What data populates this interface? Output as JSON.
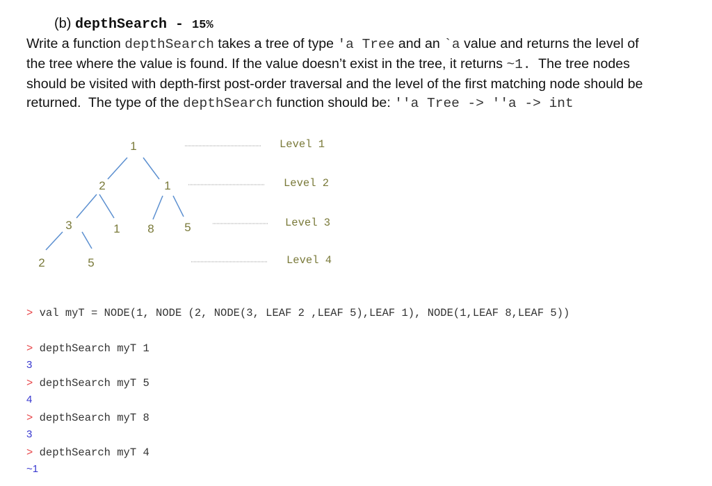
{
  "heading": {
    "part": "(b) ",
    "function_name": "depthSearch",
    "separator": " - ",
    "weight": "15%"
  },
  "description": {
    "lines": [
      [
        {
          "t": "text",
          "v": "Write a function "
        },
        {
          "t": "code",
          "v": "depthSearch"
        },
        {
          "t": "text",
          "v": " takes a tree of type "
        },
        {
          "t": "code",
          "v": "'a Tree"
        },
        {
          "t": "text",
          "v": " and an "
        },
        {
          "t": "code",
          "v": "`a"
        },
        {
          "t": "text",
          "v": " value and returns the level of"
        }
      ],
      [
        {
          "t": "text",
          "v": "the tree where the value is found. If the value doesn’t exist in the tree, it returns "
        },
        {
          "t": "code",
          "v": "~1."
        },
        {
          "t": "text",
          "v": "  The tree nodes"
        }
      ],
      [
        {
          "t": "text",
          "v": "should be visited with depth-first post-order traversal and the level of the first matching node should be"
        }
      ],
      [
        {
          "t": "text",
          "v": "returned.  The type of the "
        },
        {
          "t": "code",
          "v": "depthSearch"
        },
        {
          "t": "text",
          "v": " function should be: "
        },
        {
          "t": "code",
          "v": "''a Tree -> ''a -> int"
        }
      ]
    ]
  },
  "tree_diagram": {
    "nodes": [
      {
        "id": "n1",
        "value": "1",
        "level": 1
      },
      {
        "id": "n2",
        "value": "2",
        "level": 2
      },
      {
        "id": "n3",
        "value": "1",
        "level": 2
      },
      {
        "id": "n4",
        "value": "3",
        "level": 3
      },
      {
        "id": "n5",
        "value": "1",
        "level": 3
      },
      {
        "id": "n6",
        "value": "8",
        "level": 3
      },
      {
        "id": "n7",
        "value": "5",
        "level": 3
      },
      {
        "id": "n8",
        "value": "2",
        "level": 4
      },
      {
        "id": "n9",
        "value": "5",
        "level": 4
      }
    ],
    "edges": [
      [
        "n1",
        "n2"
      ],
      [
        "n1",
        "n3"
      ],
      [
        "n2",
        "n4"
      ],
      [
        "n2",
        "n5"
      ],
      [
        "n3",
        "n6"
      ],
      [
        "n3",
        "n7"
      ],
      [
        "n4",
        "n8"
      ],
      [
        "n4",
        "n9"
      ]
    ],
    "level_labels": [
      "Level 1",
      "Level 2",
      "Level 3",
      "Level 4"
    ]
  },
  "repl": {
    "prompt": ">",
    "definition": " val myT = NODE(1, NODE (2, NODE(3, LEAF 2 ,LEAF 5),LEAF 1), NODE(1,LEAF 8,LEAF 5))",
    "calls": [
      {
        "input": " depthSearch myT 1",
        "output": "3"
      },
      {
        "input": " depthSearch myT 5",
        "output": "4"
      },
      {
        "input": " depthSearch myT 8",
        "output": "3"
      },
      {
        "input": " depthSearch myT 4",
        "output": "~1"
      }
    ]
  }
}
